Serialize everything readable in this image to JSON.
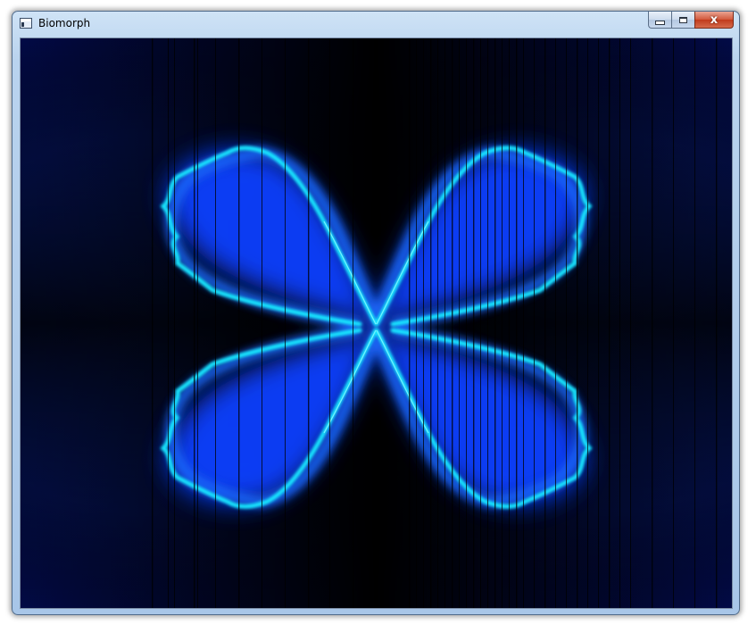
{
  "window": {
    "title": "Biomorph",
    "icon": "application-window-icon"
  },
  "caption_buttons": {
    "minimize_icon": "minimize-icon",
    "maximize_icon": "maximize-icon",
    "close_icon": "close-icon",
    "close_glyph": "x"
  },
  "render": {
    "background": "#000008",
    "glow_colors": [
      "#0018c8",
      "#0050ff",
      "#00e6ff"
    ],
    "stripe_color": "#000000"
  }
}
